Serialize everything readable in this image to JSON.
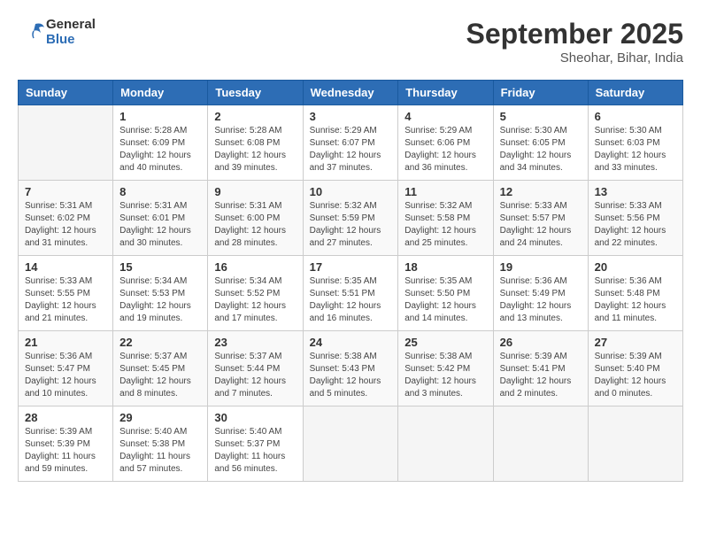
{
  "header": {
    "logo_line1": "General",
    "logo_line2": "Blue",
    "month": "September 2025",
    "location": "Sheohar, Bihar, India"
  },
  "days_of_week": [
    "Sunday",
    "Monday",
    "Tuesday",
    "Wednesday",
    "Thursday",
    "Friday",
    "Saturday"
  ],
  "weeks": [
    [
      {
        "day": "",
        "info": ""
      },
      {
        "day": "1",
        "info": "Sunrise: 5:28 AM\nSunset: 6:09 PM\nDaylight: 12 hours\nand 40 minutes."
      },
      {
        "day": "2",
        "info": "Sunrise: 5:28 AM\nSunset: 6:08 PM\nDaylight: 12 hours\nand 39 minutes."
      },
      {
        "day": "3",
        "info": "Sunrise: 5:29 AM\nSunset: 6:07 PM\nDaylight: 12 hours\nand 37 minutes."
      },
      {
        "day": "4",
        "info": "Sunrise: 5:29 AM\nSunset: 6:06 PM\nDaylight: 12 hours\nand 36 minutes."
      },
      {
        "day": "5",
        "info": "Sunrise: 5:30 AM\nSunset: 6:05 PM\nDaylight: 12 hours\nand 34 minutes."
      },
      {
        "day": "6",
        "info": "Sunrise: 5:30 AM\nSunset: 6:03 PM\nDaylight: 12 hours\nand 33 minutes."
      }
    ],
    [
      {
        "day": "7",
        "info": "Sunrise: 5:31 AM\nSunset: 6:02 PM\nDaylight: 12 hours\nand 31 minutes."
      },
      {
        "day": "8",
        "info": "Sunrise: 5:31 AM\nSunset: 6:01 PM\nDaylight: 12 hours\nand 30 minutes."
      },
      {
        "day": "9",
        "info": "Sunrise: 5:31 AM\nSunset: 6:00 PM\nDaylight: 12 hours\nand 28 minutes."
      },
      {
        "day": "10",
        "info": "Sunrise: 5:32 AM\nSunset: 5:59 PM\nDaylight: 12 hours\nand 27 minutes."
      },
      {
        "day": "11",
        "info": "Sunrise: 5:32 AM\nSunset: 5:58 PM\nDaylight: 12 hours\nand 25 minutes."
      },
      {
        "day": "12",
        "info": "Sunrise: 5:33 AM\nSunset: 5:57 PM\nDaylight: 12 hours\nand 24 minutes."
      },
      {
        "day": "13",
        "info": "Sunrise: 5:33 AM\nSunset: 5:56 PM\nDaylight: 12 hours\nand 22 minutes."
      }
    ],
    [
      {
        "day": "14",
        "info": "Sunrise: 5:33 AM\nSunset: 5:55 PM\nDaylight: 12 hours\nand 21 minutes."
      },
      {
        "day": "15",
        "info": "Sunrise: 5:34 AM\nSunset: 5:53 PM\nDaylight: 12 hours\nand 19 minutes."
      },
      {
        "day": "16",
        "info": "Sunrise: 5:34 AM\nSunset: 5:52 PM\nDaylight: 12 hours\nand 17 minutes."
      },
      {
        "day": "17",
        "info": "Sunrise: 5:35 AM\nSunset: 5:51 PM\nDaylight: 12 hours\nand 16 minutes."
      },
      {
        "day": "18",
        "info": "Sunrise: 5:35 AM\nSunset: 5:50 PM\nDaylight: 12 hours\nand 14 minutes."
      },
      {
        "day": "19",
        "info": "Sunrise: 5:36 AM\nSunset: 5:49 PM\nDaylight: 12 hours\nand 13 minutes."
      },
      {
        "day": "20",
        "info": "Sunrise: 5:36 AM\nSunset: 5:48 PM\nDaylight: 12 hours\nand 11 minutes."
      }
    ],
    [
      {
        "day": "21",
        "info": "Sunrise: 5:36 AM\nSunset: 5:47 PM\nDaylight: 12 hours\nand 10 minutes."
      },
      {
        "day": "22",
        "info": "Sunrise: 5:37 AM\nSunset: 5:45 PM\nDaylight: 12 hours\nand 8 minutes."
      },
      {
        "day": "23",
        "info": "Sunrise: 5:37 AM\nSunset: 5:44 PM\nDaylight: 12 hours\nand 7 minutes."
      },
      {
        "day": "24",
        "info": "Sunrise: 5:38 AM\nSunset: 5:43 PM\nDaylight: 12 hours\nand 5 minutes."
      },
      {
        "day": "25",
        "info": "Sunrise: 5:38 AM\nSunset: 5:42 PM\nDaylight: 12 hours\nand 3 minutes."
      },
      {
        "day": "26",
        "info": "Sunrise: 5:39 AM\nSunset: 5:41 PM\nDaylight: 12 hours\nand 2 minutes."
      },
      {
        "day": "27",
        "info": "Sunrise: 5:39 AM\nSunset: 5:40 PM\nDaylight: 12 hours\nand 0 minutes."
      }
    ],
    [
      {
        "day": "28",
        "info": "Sunrise: 5:39 AM\nSunset: 5:39 PM\nDaylight: 11 hours\nand 59 minutes."
      },
      {
        "day": "29",
        "info": "Sunrise: 5:40 AM\nSunset: 5:38 PM\nDaylight: 11 hours\nand 57 minutes."
      },
      {
        "day": "30",
        "info": "Sunrise: 5:40 AM\nSunset: 5:37 PM\nDaylight: 11 hours\nand 56 minutes."
      },
      {
        "day": "",
        "info": ""
      },
      {
        "day": "",
        "info": ""
      },
      {
        "day": "",
        "info": ""
      },
      {
        "day": "",
        "info": ""
      }
    ]
  ]
}
